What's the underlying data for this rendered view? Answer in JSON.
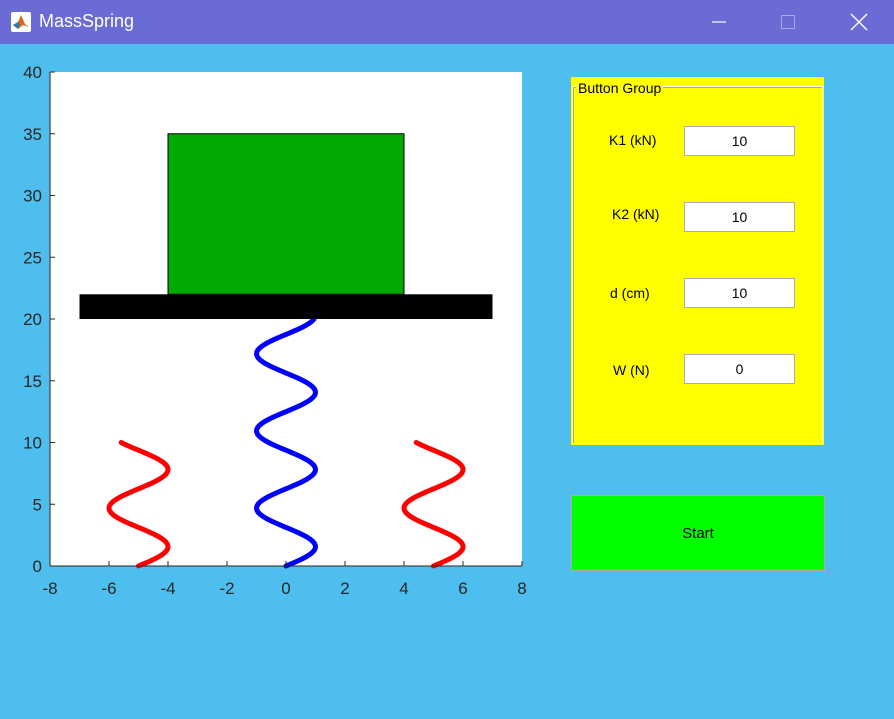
{
  "window": {
    "title": "MassSpring",
    "icon": "matlab-logo-icon",
    "controls": [
      "minimize-icon",
      "maximize-icon",
      "close-icon"
    ]
  },
  "plot": {
    "x_ticks": [
      "-8",
      "-6",
      "-4",
      "-2",
      "0",
      "2",
      "4",
      "6",
      "8"
    ],
    "y_ticks": [
      "0",
      "5",
      "10",
      "15",
      "20",
      "25",
      "30",
      "35",
      "40"
    ],
    "xlim": [
      -8,
      8
    ],
    "ylim": [
      0,
      40
    ],
    "mass": {
      "x": [
        -4,
        4
      ],
      "y": [
        22,
        35
      ],
      "color": "#00aa00"
    },
    "platform": {
      "x": [
        -7,
        7
      ],
      "y": [
        20,
        22
      ],
      "color": "#000000"
    },
    "center_spring": {
      "color": "#0000ff",
      "center_x": 0,
      "amplitude": 1,
      "y_range": [
        0,
        20
      ]
    },
    "side_springs": [
      {
        "color": "#ff0000",
        "center_x": -5,
        "amplitude": 1,
        "y_range": [
          0,
          10
        ]
      },
      {
        "color": "#ff0000",
        "center_x": 5,
        "amplitude": 1,
        "y_range": [
          0,
          10
        ]
      }
    ]
  },
  "button_group": {
    "title": "Button Group",
    "color": "#ffff00",
    "fields": [
      {
        "label": "K1 (kN)",
        "value": "10"
      },
      {
        "label": "K2 (kN)",
        "value": "10"
      },
      {
        "label": "d (cm)",
        "value": "10"
      },
      {
        "label": "W (N)",
        "value": "0"
      }
    ]
  },
  "start_button": {
    "label": "Start",
    "color": "#00ff00"
  }
}
